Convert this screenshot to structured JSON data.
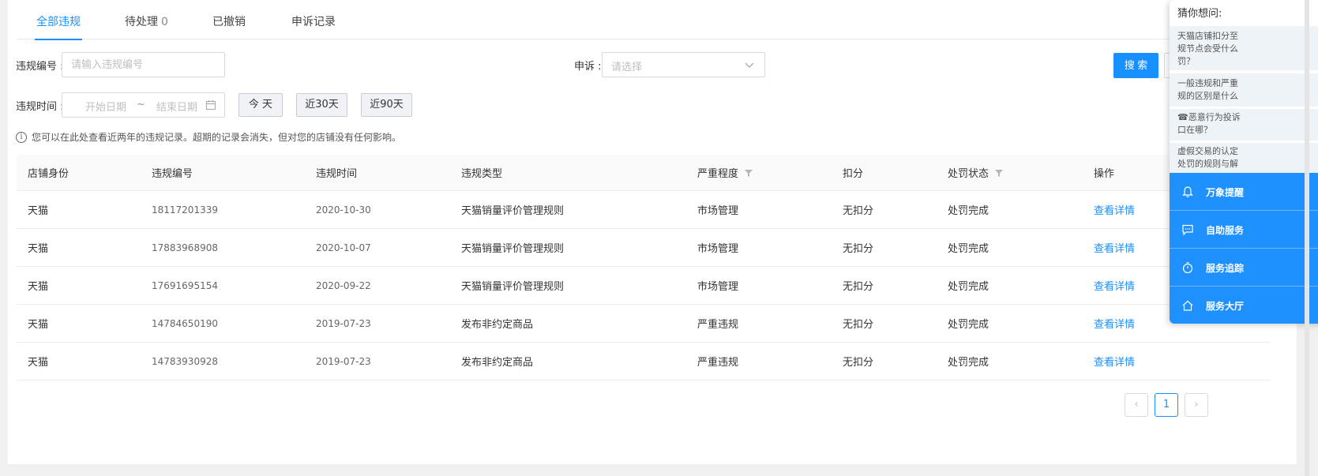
{
  "tabs": [
    {
      "label": "全部违规",
      "count": ""
    },
    {
      "label": "待处理",
      "count": "0"
    },
    {
      "label": "已撤销",
      "count": ""
    },
    {
      "label": "申诉记录",
      "count": ""
    }
  ],
  "filters": {
    "violation_no_label": "违规编号 :",
    "violation_no_placeholder": "请输入违规编号",
    "appeal_label": "申诉 :",
    "appeal_placeholder": "请选择",
    "search_button": "搜 索",
    "time_label": "违规时间 :",
    "start_date_placeholder": "开始日期",
    "range_sep": "~",
    "end_date_placeholder": "结束日期",
    "quick": [
      "今 天",
      "近30天",
      "近90天"
    ]
  },
  "tip": "您可以在此处查看近两年的违规记录。超期的记录会消失，但对您的店铺没有任何影响。",
  "table": {
    "headers": [
      "店铺身份",
      "违规编号",
      "违规时间",
      "违规类型",
      "严重程度",
      "扣分",
      "处罚状态",
      "操作"
    ],
    "rows": [
      [
        "天猫",
        "18117201339",
        "2020-10-30",
        "天猫销量评价管理规则",
        "市场管理",
        "无扣分",
        "处罚完成",
        "查看详情"
      ],
      [
        "天猫",
        "17883968908",
        "2020-10-07",
        "天猫销量评价管理规则",
        "市场管理",
        "无扣分",
        "处罚完成",
        "查看详情"
      ],
      [
        "天猫",
        "17691695154",
        "2020-09-22",
        "天猫销量评价管理规则",
        "市场管理",
        "无扣分",
        "处罚完成",
        "查看详情"
      ],
      [
        "天猫",
        "14784650190",
        "2019-07-23",
        "发布非约定商品",
        "严重违规",
        "无扣分",
        "处罚完成",
        "查看详情"
      ],
      [
        "天猫",
        "14783930928",
        "2019-07-23",
        "发布非约定商品",
        "严重违规",
        "无扣分",
        "处罚完成",
        "查看详情"
      ]
    ]
  },
  "pagination": {
    "prev": "‹",
    "current": "1",
    "next": "›"
  },
  "side_panel": {
    "title": "猜你想问:",
    "questions": [
      [
        "天猫店铺扣分至",
        "规节点会受什么",
        "罚？"
      ],
      [
        "一般违规和严重",
        "规的区别是什么"
      ],
      [
        "☎恶意行为投诉",
        "口在哪？"
      ],
      [
        "虚假交易的认定",
        "处罚的规则与解"
      ]
    ],
    "menu": [
      "万象提醒",
      "自助服务",
      "服务追踪",
      "服务大厅"
    ]
  },
  "colors": {
    "accent": "#1890ff",
    "side_blue": "#1e90ff"
  }
}
